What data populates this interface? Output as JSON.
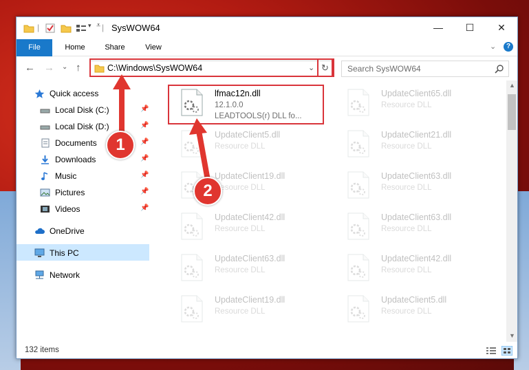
{
  "window": {
    "title": "SysWOW64"
  },
  "ribbon": {
    "file": "File",
    "home": "Home",
    "share": "Share",
    "view": "View"
  },
  "address": {
    "path": "C:\\Windows\\SysWOW64"
  },
  "search": {
    "placeholder": "Search SysWOW64"
  },
  "sidebar": {
    "items": [
      {
        "label": "Quick access",
        "icon": "star-icon"
      },
      {
        "label": "Local Disk (C:)",
        "icon": "drive-icon"
      },
      {
        "label": "Local Disk (D:)",
        "icon": "drive-icon"
      },
      {
        "label": "Documents",
        "icon": "documents-icon"
      },
      {
        "label": "Downloads",
        "icon": "downloads-icon"
      },
      {
        "label": "Music",
        "icon": "music-icon"
      },
      {
        "label": "Pictures",
        "icon": "pictures-icon"
      },
      {
        "label": "Videos",
        "icon": "videos-icon"
      },
      {
        "label": "OneDrive",
        "icon": "cloud-icon"
      },
      {
        "label": "This PC",
        "icon": "computer-icon"
      },
      {
        "label": "Network",
        "icon": "network-icon"
      }
    ]
  },
  "files": [
    {
      "name": "lfmac12n.dll",
      "line2": "12.1.0.0",
      "line3": "LEADTOOLS(r) DLL fo..."
    },
    {
      "name": "UpdateClient65.dll",
      "line2": "Resource DLL"
    },
    {
      "name": "UpdateClient5.dll",
      "line2": "Resource DLL"
    },
    {
      "name": "UpdateClient21.dll",
      "line2": "Resource DLL"
    },
    {
      "name": "UpdateClient19.dll",
      "line2": "Resource DLL"
    },
    {
      "name": "UpdateClient63.dll",
      "line2": "Resource DLL"
    },
    {
      "name": "UpdateClient42.dll",
      "line2": "Resource DLL"
    },
    {
      "name": "UpdateClient63.dll",
      "line2": "Resource DLL"
    },
    {
      "name": "UpdateClient63.dll",
      "line2": "Resource DLL"
    },
    {
      "name": "UpdateClient42.dll",
      "line2": "Resource DLL"
    },
    {
      "name": "UpdateClient19.dll",
      "line2": "Resource DLL"
    },
    {
      "name": "UpdateClient5.dll",
      "line2": "Resource DLL"
    }
  ],
  "status": {
    "count": "132 items"
  },
  "callouts": {
    "one": "1",
    "two": "2"
  },
  "colors": {
    "accent": "#1979ca",
    "highlight": "#d9343a",
    "selection": "#cce8ff"
  }
}
